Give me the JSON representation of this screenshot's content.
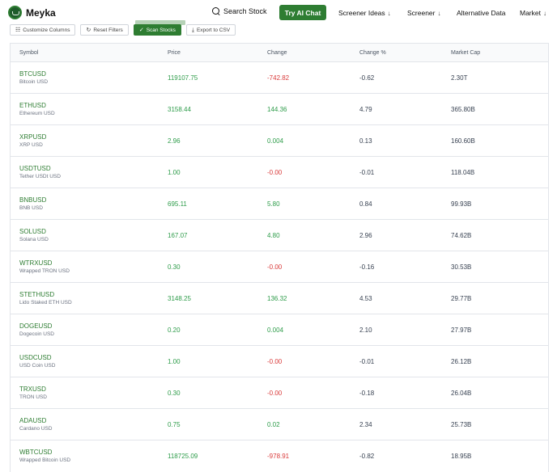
{
  "brand": {
    "name": "Meyka"
  },
  "nav": {
    "search_label": "Search Stock",
    "ai_chat_label": "Try AI Chat",
    "screener_ideas_label": "Screener Ideas",
    "screener_label": "Screener",
    "alternative_data_label": "Alternative Data",
    "market_label": "Market",
    "arrow_glyph": "↓"
  },
  "toolbar": {
    "customize_label": "Customize Columns",
    "reset_label": "Reset Filters",
    "scan_label": "Scan Stocks",
    "export_label": "Export to CSV"
  },
  "table": {
    "headers": [
      "Symbol",
      "Price",
      "Change",
      "Change %",
      "Market Cap"
    ],
    "rows": [
      {
        "symbol": "BTCUSD",
        "name": "Bitcoin USD",
        "price": "119107.75",
        "change": "-742.82",
        "change_pct": "-0.62",
        "market_cap": "2.30T"
      },
      {
        "symbol": "ETHUSD",
        "name": "Ethereum USD",
        "price": "3158.44",
        "change": "144.36",
        "change_pct": "4.79",
        "market_cap": "365.80B"
      },
      {
        "symbol": "XRPUSD",
        "name": "XRP USD",
        "price": "2.96",
        "change": "0.004",
        "change_pct": "0.13",
        "market_cap": "160.60B"
      },
      {
        "symbol": "USDTUSD",
        "name": "Tether USDt USD",
        "price": "1.00",
        "change": "-0.00",
        "change_pct": "-0.01",
        "market_cap": "118.04B"
      },
      {
        "symbol": "BNBUSD",
        "name": "BNB USD",
        "price": "695.11",
        "change": "5.80",
        "change_pct": "0.84",
        "market_cap": "99.93B"
      },
      {
        "symbol": "SOLUSD",
        "name": "Solana USD",
        "price": "167.07",
        "change": "4.80",
        "change_pct": "2.96",
        "market_cap": "74.62B"
      },
      {
        "symbol": "WTRXUSD",
        "name": "Wrapped TRON USD",
        "price": "0.30",
        "change": "-0.00",
        "change_pct": "-0.16",
        "market_cap": "30.53B"
      },
      {
        "symbol": "STETHUSD",
        "name": "Lido Staked ETH USD",
        "price": "3148.25",
        "change": "136.32",
        "change_pct": "4.53",
        "market_cap": "29.77B"
      },
      {
        "symbol": "DOGEUSD",
        "name": "Dogecoin USD",
        "price": "0.20",
        "change": "0.004",
        "change_pct": "2.10",
        "market_cap": "27.97B"
      },
      {
        "symbol": "USDCUSD",
        "name": "USD Coin USD",
        "price": "1.00",
        "change": "-0.00",
        "change_pct": "-0.01",
        "market_cap": "26.12B"
      },
      {
        "symbol": "TRXUSD",
        "name": "TRON USD",
        "price": "0.30",
        "change": "-0.00",
        "change_pct": "-0.18",
        "market_cap": "26.04B"
      },
      {
        "symbol": "ADAUSD",
        "name": "Cardano USD",
        "price": "0.75",
        "change": "0.02",
        "change_pct": "2.34",
        "market_cap": "25.73B"
      },
      {
        "symbol": "WBTCUSD",
        "name": "Wrapped Bitcoin USD",
        "price": "118725.09",
        "change": "-978.91",
        "change_pct": "-0.82",
        "market_cap": "18.95B"
      }
    ]
  },
  "colors": {
    "brand_green": "#2e7d32",
    "positive": "#2e9c4a",
    "negative": "#d93a3a"
  }
}
